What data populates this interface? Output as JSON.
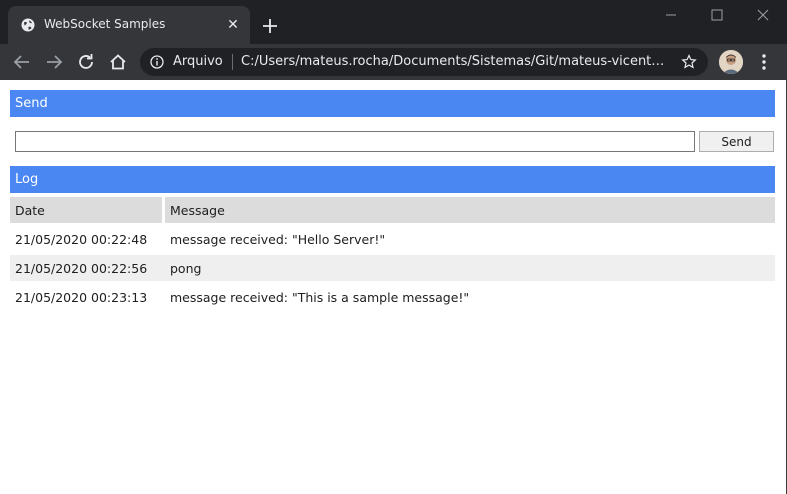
{
  "browser": {
    "tab_title": "WebSocket Samples",
    "site_label": "Arquivo",
    "url": "C:/Users/mateus.rocha/Documents/Sistemas/Git/mateus-vicente/w...",
    "colors": {
      "frame": "#202124",
      "toolbar": "#35363a",
      "text": "#e8eaed"
    }
  },
  "send_section": {
    "header": "Send",
    "input_value": "",
    "button_label": "Send"
  },
  "log_section": {
    "header": "Log",
    "columns": [
      "Date",
      "Message"
    ],
    "rows": [
      {
        "date": "21/05/2020 00:22:48",
        "message": "message received: \"Hello Server!\""
      },
      {
        "date": "21/05/2020 00:22:56",
        "message": "pong"
      },
      {
        "date": "21/05/2020 00:23:13",
        "message": "message received: \"This is a sample message!\""
      }
    ]
  },
  "colors": {
    "accent": "#4a87f2",
    "header_row": "#dcdcdc",
    "alt_row": "#efefef"
  }
}
